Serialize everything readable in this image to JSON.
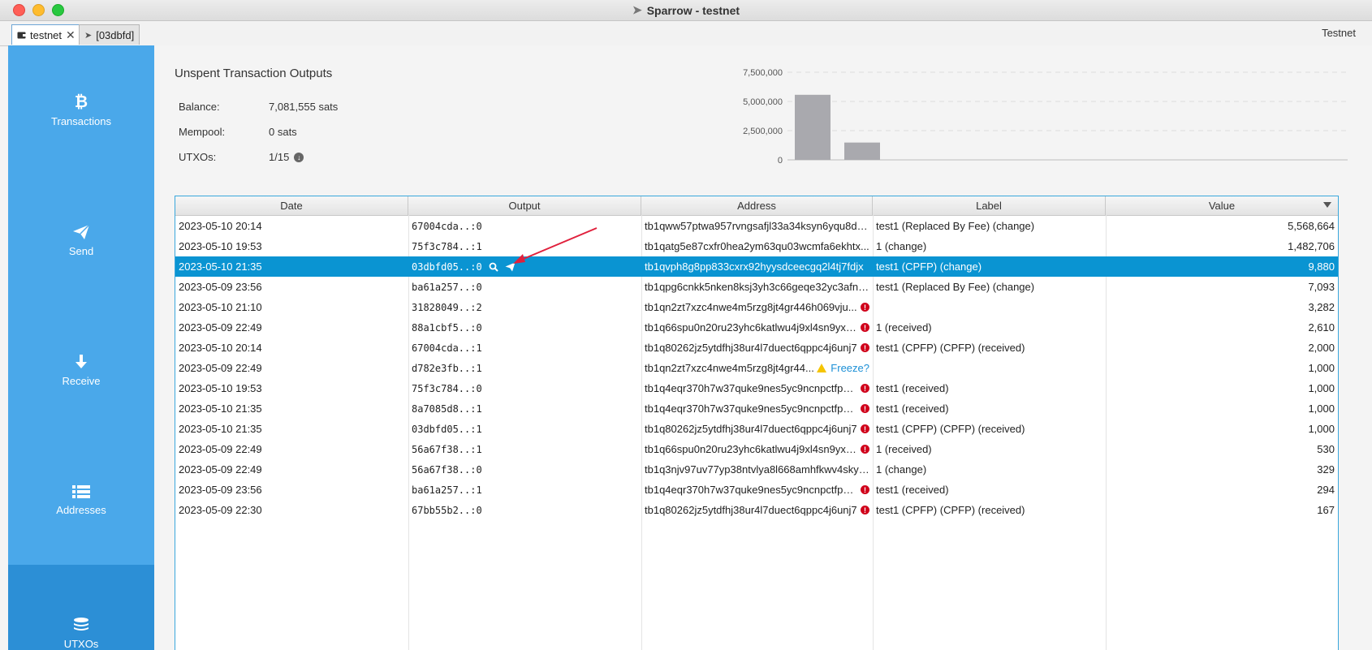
{
  "window": {
    "title": "Sparrow - testnet"
  },
  "tabs": [
    {
      "label": "testnet",
      "close": "✕",
      "active": true
    },
    {
      "label": "[03dbfd]",
      "active": false
    }
  ],
  "network": "Testnet",
  "sidebar": {
    "items": [
      {
        "label": "Transactions",
        "icon": "bitcoin-icon"
      },
      {
        "label": "Send",
        "icon": "send-icon"
      },
      {
        "label": "Receive",
        "icon": "receive-icon"
      },
      {
        "label": "Addresses",
        "icon": "list-icon"
      },
      {
        "label": "UTXOs",
        "icon": "coins-icon",
        "active": true
      }
    ]
  },
  "summary": {
    "title": "Unspent Transaction Outputs",
    "balance_label": "Balance:",
    "balance_value": "7,081,555 sats",
    "mempool_label": "Mempool:",
    "mempool_value": "0 sats",
    "utxos_label": "UTXOs:",
    "utxos_value": "1/15"
  },
  "chart_data": {
    "type": "bar",
    "ylim": [
      0,
      7500000
    ],
    "y_ticks": [
      "7,500,000",
      "5,000,000",
      "2,500,000",
      "0"
    ],
    "values": [
      5568664,
      1482706
    ],
    "bar_color": "#a9a9ae"
  },
  "table": {
    "columns": [
      "Date",
      "Output",
      "Address",
      "Label",
      "Value"
    ],
    "rows": [
      {
        "date": "2023-05-10 20:14",
        "output": "67004cda..:0",
        "address": "tb1qww57ptwa957rvngsafjl33a34ksyn6yqu8dc...",
        "warn": false,
        "label": "test1 (Replaced By Fee) (change)",
        "value": "5,568,664"
      },
      {
        "date": "2023-05-10 19:53",
        "output": "75f3c784..:1",
        "address": "tb1qatg5e87cxfr0hea2ym63qu03wcmfa6ekhtx...",
        "warn": false,
        "label": "1 (change)",
        "value": "1,482,706"
      },
      {
        "date": "2023-05-10 21:35",
        "output": "03dbfd05..:0",
        "address": "tb1qvph8g8pp833cxrx92hyysdceecgq2l4tj7fdjx",
        "warn": false,
        "label": "test1 (CPFP) (change)",
        "value": "9,880",
        "selected": true
      },
      {
        "date": "2023-05-09 23:56",
        "output": "ba61a257..:0",
        "address": "tb1qpg6cnkk5nken8ksj3yh3c66geqe32yc3afnh...",
        "warn": false,
        "label": "test1 (Replaced By Fee) (change)",
        "value": "7,093"
      },
      {
        "date": "2023-05-10 21:10",
        "output": "31828049..:2",
        "address": "tb1qn2zt7xzc4nwe4m5rzg8jt4gr446h069vju...",
        "warn": true,
        "label": "",
        "value": "3,282"
      },
      {
        "date": "2023-05-09 22:49",
        "output": "88a1cbf5..:0",
        "address": "tb1q66spu0n20ru23yhc6katlwu4j9xl4sn9yxr...",
        "warn": true,
        "label": "1 (received)",
        "value": "2,610"
      },
      {
        "date": "2023-05-10 20:14",
        "output": "67004cda..:1",
        "address": "tb1q80262jz5ytdfhj38ur4l7duect6qppc4j6unj7",
        "warn": true,
        "label": "test1 (CPFP) (CPFP) (received)",
        "value": "2,000"
      },
      {
        "date": "2023-05-09 22:49",
        "output": "d782e3fb..:1",
        "address": "tb1qn2zt7xzc4nwe4m5rzg8jt4gr44...",
        "warn": false,
        "freeze": "Freeze?",
        "label": "",
        "value": "1,000"
      },
      {
        "date": "2023-05-10 19:53",
        "output": "75f3c784..:0",
        "address": "tb1q4eqr370h7w37quke9nes5yc9ncnpctfpej...",
        "warn": true,
        "label": "test1 (received)",
        "value": "1,000"
      },
      {
        "date": "2023-05-10 21:35",
        "output": "8a7085d8..:1",
        "address": "tb1q4eqr370h7w37quke9nes5yc9ncnpctfpej...",
        "warn": true,
        "label": "test1 (received)",
        "value": "1,000"
      },
      {
        "date": "2023-05-10 21:35",
        "output": "03dbfd05..:1",
        "address": "tb1q80262jz5ytdfhj38ur4l7duect6qppc4j6unj7",
        "warn": true,
        "label": "test1 (CPFP) (CPFP) (received)",
        "value": "1,000"
      },
      {
        "date": "2023-05-09 22:49",
        "output": "56a67f38..:1",
        "address": "tb1q66spu0n20ru23yhc6katlwu4j9xl4sn9yxr...",
        "warn": true,
        "label": "1 (received)",
        "value": "530"
      },
      {
        "date": "2023-05-09 22:49",
        "output": "56a67f38..:0",
        "address": "tb1q3njv97uv77yp38ntvlya8l668amhfkwv4sky0s",
        "warn": false,
        "label": "1 (change)",
        "value": "329"
      },
      {
        "date": "2023-05-09 23:56",
        "output": "ba61a257..:1",
        "address": "tb1q4eqr370h7w37quke9nes5yc9ncnpctfpej...",
        "warn": true,
        "label": "test1 (received)",
        "value": "294"
      },
      {
        "date": "2023-05-09 22:30",
        "output": "67bb55b2..:0",
        "address": "tb1q80262jz5ytdfhj38ur4l7duect6qppc4j6unj7",
        "warn": true,
        "label": "test1 (CPFP) (CPFP) (received)",
        "value": "167"
      }
    ]
  }
}
